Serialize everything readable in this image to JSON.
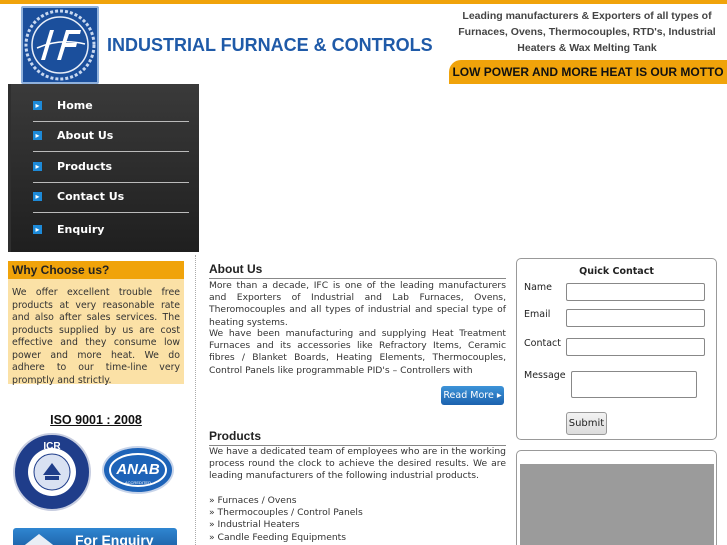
{
  "header": {
    "logo_text": "IF",
    "brand": "INDUSTRIAL FURNACE & CONTROLS",
    "tagline": "Leading manufacturers & Exporters of all types of Furnaces, Ovens, Thermocouples, RTD's, Industrial Heaters & Wax Melting Tank",
    "motto": "LOW POWER AND MORE HEAT IS OUR MOTTO",
    "accent_color": "#f0a30a",
    "brand_color": "#1f5aa8"
  },
  "nav": {
    "items": [
      {
        "label": "Home"
      },
      {
        "label": "About Us"
      },
      {
        "label": "Products"
      },
      {
        "label": "Contact Us"
      },
      {
        "label": "Enquiry"
      }
    ],
    "bullet_icon": "chevron-right-icon"
  },
  "why": {
    "title": "Why Choose us?",
    "text": "We offer excellent trouble free products at very reasonable rate and also after sales services. The products supplied by us are cost effective and they consume low power and more heat. We do adhere to our time-line very promptly and strictly."
  },
  "certs": {
    "iso": "ISO 9001 : 2008",
    "icr_text": "ICR",
    "anab_text": "ANAB",
    "anab_sub": "ACCREDITED"
  },
  "enquiry_banner": {
    "label": "For Enquiry"
  },
  "about": {
    "title": "About Us",
    "p1": "More than a decade, IFC is one of the leading manufacturers and Exporters of Industrial and Lab Furnaces, Ovens, Theromocouples and all types of industrial and special type of heating systems.",
    "p2": "We have been manufacturing and supplying Heat Treatment Furnaces and its accessories like Refractory Items, Ceramic fibres / Blanket Boards, Heating Elements, Thermocouples, Control Panels like programmable PID's – Controllers with",
    "read_more": "Read More"
  },
  "products": {
    "title": "Products",
    "intro": "We have a dedicated team of employees who are in the working process round the clock to achieve the desired results. We are leading manufacturers of the following industrial products.",
    "items": [
      "» Furnaces / Ovens",
      "» Thermocouples / Control Panels",
      "» Industrial Heaters",
      "» Candle Feeding Equipments"
    ]
  },
  "quick_contact": {
    "title": "Quick Contact",
    "name_label": "Name",
    "email_label": "Email",
    "contact_label": "Contact",
    "message_label": "Message",
    "name_value": "",
    "email_value": "",
    "contact_value": "",
    "message_value": "",
    "submit": "Submit"
  }
}
